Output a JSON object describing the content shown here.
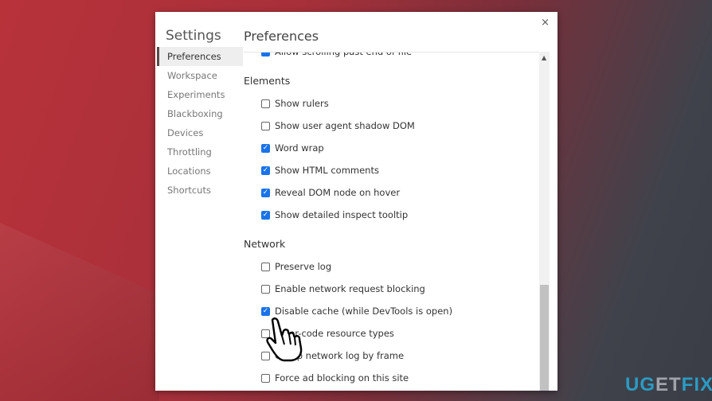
{
  "dialog": {
    "close": "×",
    "title": "Settings",
    "page_title": "Preferences"
  },
  "sidebar": {
    "items": [
      {
        "label": "Preferences",
        "selected": true
      },
      {
        "label": "Workspace"
      },
      {
        "label": "Experiments"
      },
      {
        "label": "Blackboxing"
      },
      {
        "label": "Devices"
      },
      {
        "label": "Throttling"
      },
      {
        "label": "Locations"
      },
      {
        "label": "Shortcuts"
      }
    ]
  },
  "content": {
    "top_item": {
      "label": "Allow scrolling past end of file",
      "checked": true
    },
    "sections": [
      {
        "title": "Elements",
        "items": [
          {
            "label": "Show rulers",
            "checked": false
          },
          {
            "label": "Show user agent shadow DOM",
            "checked": false
          },
          {
            "label": "Word wrap",
            "checked": true
          },
          {
            "label": "Show HTML comments",
            "checked": true
          },
          {
            "label": "Reveal DOM node on hover",
            "checked": true
          },
          {
            "label": "Show detailed inspect tooltip",
            "checked": true
          }
        ]
      },
      {
        "title": "Network",
        "items": [
          {
            "label": "Preserve log",
            "checked": false
          },
          {
            "label": "Enable network request blocking",
            "checked": false
          },
          {
            "label": "Disable cache (while DevTools is open)",
            "checked": true
          },
          {
            "label": "Color-code resource types",
            "checked": false
          },
          {
            "label": "Group network log by frame",
            "checked": false
          },
          {
            "label": "Force ad blocking on this site",
            "checked": false
          }
        ]
      }
    ]
  },
  "watermark": {
    "part1": "UG",
    "part2": "ET",
    "part3": "FIX"
  },
  "colors": {
    "accent": "#1a73e8",
    "logo_blue": "#2a9bc4"
  }
}
